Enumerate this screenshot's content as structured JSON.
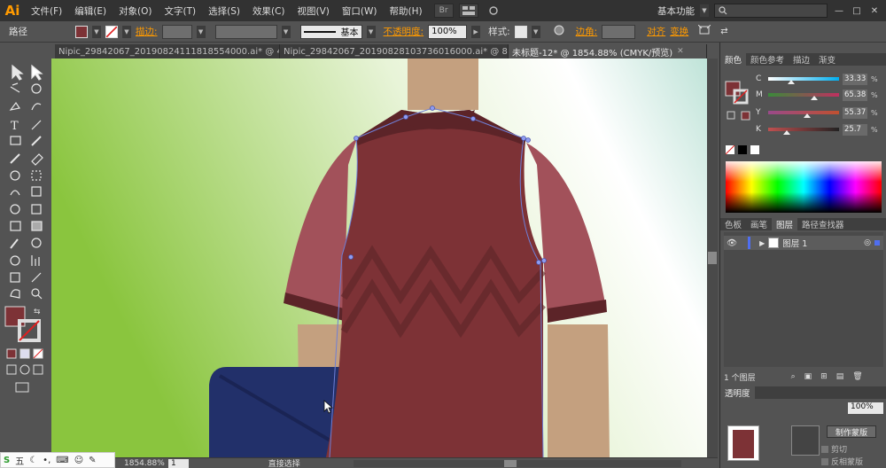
{
  "menu": {
    "logo": "Ai",
    "items": [
      "文件(F)",
      "编辑(E)",
      "对象(O)",
      "文字(T)",
      "选择(S)",
      "效果(C)",
      "视图(V)",
      "窗口(W)",
      "帮助(H)"
    ],
    "br_button": "Br",
    "workspace": "基本功能",
    "minimize": "—",
    "maximize": "□",
    "close": "✕"
  },
  "control": {
    "path_label": "路径",
    "stroke_label": "描边:",
    "stroke_style": "基本",
    "opacity_label": "不透明度:",
    "opacity_value": "100%",
    "style_label": "样式:",
    "corner_label": "边角:",
    "align_label": "对齐",
    "transform_label": "变换",
    "fill_color": "#7d3236"
  },
  "tabs": [
    {
      "label": "Nipic_29842067_20190824111818554000.ai* @ 42...",
      "active": false
    },
    {
      "label": "Nipic_29842067_20190828103736016000.ai* @ 80...",
      "active": false
    },
    {
      "label": "未标题-12* @ 1854.88% (CMYK/预览)",
      "active": true
    }
  ],
  "status": {
    "zoom": "1854.88%",
    "page": "1",
    "tool_name": "直接选择"
  },
  "ime": {
    "label": "五"
  },
  "panels": {
    "color_tabs": [
      "颜色",
      "颜色参考",
      "描边",
      "渐变"
    ],
    "cmyk": [
      {
        "letter": "C",
        "value": "33.33",
        "pct": "%",
        "level": 0.33,
        "from": "#ffffff",
        "to": "#00aeef"
      },
      {
        "letter": "M",
        "value": "65.38",
        "pct": "%",
        "level": 0.65,
        "from": "#3a8a3a",
        "to": "#c03060"
      },
      {
        "letter": "Y",
        "value": "55.37",
        "pct": "%",
        "level": 0.55,
        "from": "#9a4a8a",
        "to": "#c05030"
      },
      {
        "letter": "K",
        "value": "25.7",
        "pct": "%",
        "level": 0.26,
        "from": "#c05050",
        "to": "#222222"
      }
    ],
    "layer_tabs": [
      "色板",
      "画笔",
      "图层",
      "路径查找器"
    ],
    "layer_name": "图层 1",
    "layer_count": "1 个图层",
    "transparency_tab": "透明度",
    "opacity_value": "100%",
    "make_mask_label": "制作蒙版",
    "clip_label": "剪切",
    "invert_mask_label": "反相蒙版"
  },
  "colors": {
    "shirt": "#7d3236",
    "sleeve": "#a2515a",
    "collar": "#5c2428",
    "skin": "#c4a07f",
    "pants": "#22306a",
    "bg_green": "#8ac53e"
  }
}
